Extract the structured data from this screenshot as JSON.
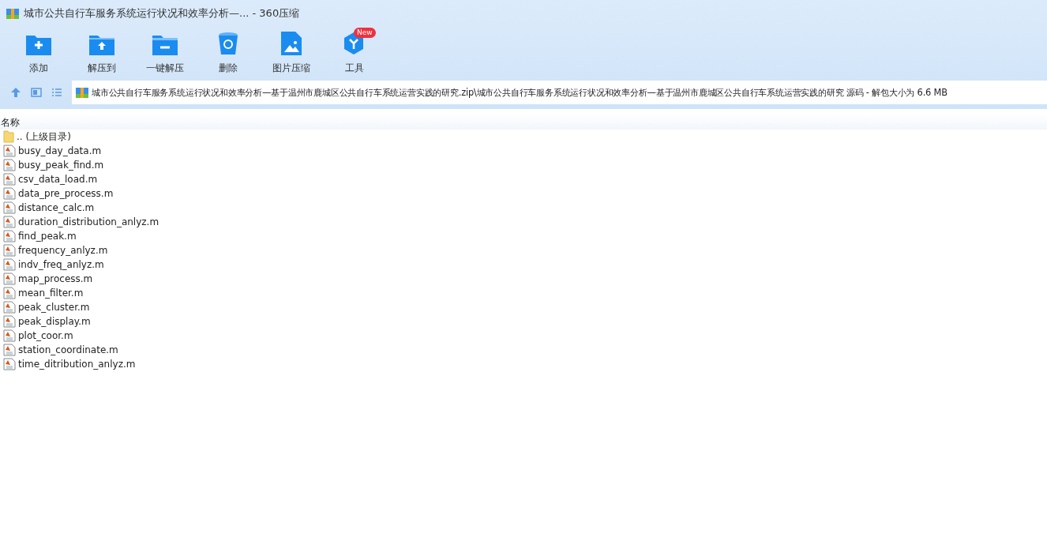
{
  "window": {
    "title": "城市公共自行车服务系统运行状况和效率分析—... - 360压缩"
  },
  "toolbar": [
    {
      "kind": "add",
      "label": "添加"
    },
    {
      "kind": "extract",
      "label": "解压到"
    },
    {
      "kind": "quick",
      "label": "一键解压"
    },
    {
      "kind": "delete",
      "label": "删除"
    },
    {
      "kind": "image",
      "label": "图片压缩"
    },
    {
      "kind": "tools",
      "label": "工具",
      "badge": "New"
    }
  ],
  "address": {
    "path": "城市公共自行车服务系统运行状况和效率分析—基于温州市鹿城区公共自行车系统运营实践的研究.zip\\城市公共自行车服务系统运行状况和效率分析—基于温州市鹿城区公共自行车系统运营实践的研究 源码 - 解包大小为 6.6 MB"
  },
  "list": {
    "columns": [
      "名称"
    ],
    "rows": [
      {
        "kind": "parent",
        "name": ".. (上级目录)"
      },
      {
        "kind": "file",
        "name": "busy_day_data.m"
      },
      {
        "kind": "file",
        "name": "busy_peak_find.m"
      },
      {
        "kind": "file",
        "name": "csv_data_load.m"
      },
      {
        "kind": "file",
        "name": "data_pre_process.m"
      },
      {
        "kind": "file",
        "name": "distance_calc.m"
      },
      {
        "kind": "file",
        "name": "duration_distribution_anlyz.m"
      },
      {
        "kind": "file",
        "name": "find_peak.m"
      },
      {
        "kind": "file",
        "name": "frequency_anlyz.m"
      },
      {
        "kind": "file",
        "name": "indv_freq_anlyz.m"
      },
      {
        "kind": "file",
        "name": "map_process.m"
      },
      {
        "kind": "file",
        "name": "mean_filter.m"
      },
      {
        "kind": "file",
        "name": "peak_cluster.m"
      },
      {
        "kind": "file",
        "name": "peak_display.m"
      },
      {
        "kind": "file",
        "name": "plot_coor.m"
      },
      {
        "kind": "file",
        "name": "station_coordinate.m"
      },
      {
        "kind": "file",
        "name": "time_ditribution_anlyz.m"
      }
    ]
  }
}
